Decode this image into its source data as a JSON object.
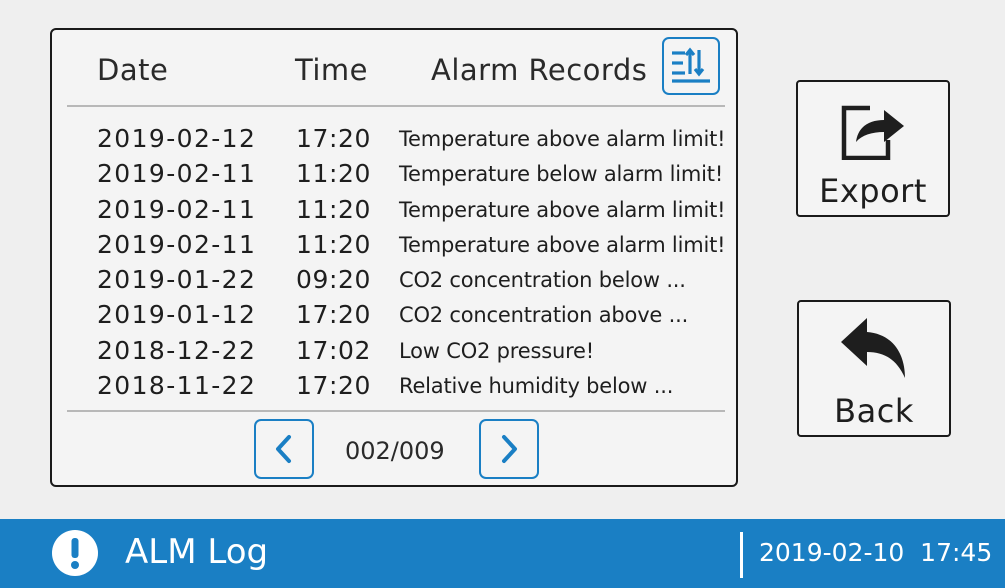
{
  "table": {
    "headers": {
      "date": "Date",
      "time": "Time",
      "records": "Alarm Records"
    },
    "rows": [
      {
        "date": "2019-02-12",
        "time": "17:20",
        "message": "Temperature above alarm limit!"
      },
      {
        "date": "2019-02-11",
        "time": "11:20",
        "message": "Temperature below alarm limit!"
      },
      {
        "date": "2019-02-11",
        "time": "11:20",
        "message": "Temperature above alarm limit!"
      },
      {
        "date": "2019-02-11",
        "time": "11:20",
        "message": "Temperature above alarm limit!"
      },
      {
        "date": "2019-01-22",
        "time": "09:20",
        "message": "CO2 concentration below ..."
      },
      {
        "date": "2019-01-12",
        "time": "17:20",
        "message": "CO2 concentration above ..."
      },
      {
        "date": "2018-12-22",
        "time": "17:02",
        "message": "Low CO2 pressure!"
      },
      {
        "date": "2018-11-22",
        "time": "17:20",
        "message": "Relative humidity  below ..."
      }
    ]
  },
  "pagination": {
    "label": "002/009",
    "prev_icon": "chevron-left-icon",
    "next_icon": "chevron-right-icon"
  },
  "sort_button": {
    "icon": "sort-icon"
  },
  "actions": {
    "export_label": "Export",
    "export_icon": "export-share-icon",
    "back_label": "Back",
    "back_icon": "back-arrow-icon"
  },
  "status_bar": {
    "icon": "alert-icon",
    "title": "ALM Log",
    "datetime": "2019-02-10  17:45"
  },
  "colors": {
    "accent": "#1a7fc4",
    "background": "#efefef",
    "border": "#1a1a1a",
    "text": "#1e1e1e",
    "status_text": "#ffffff"
  }
}
